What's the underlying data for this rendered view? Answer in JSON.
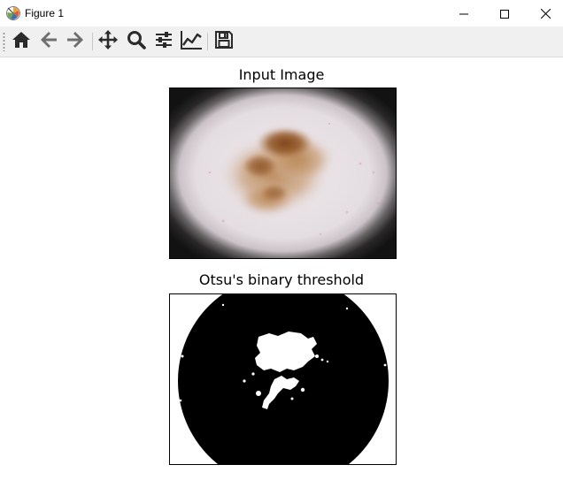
{
  "window": {
    "title": "Figure 1",
    "app_icon": "matplotlib-logo-icon",
    "controls": {
      "minimize_icon": "minimize-icon",
      "maximize_icon": "maximize-icon",
      "close_icon": "close-icon"
    }
  },
  "toolbar": {
    "buttons": [
      {
        "name": "home",
        "icon": "home-icon"
      },
      {
        "name": "back",
        "icon": "arrow-left-icon"
      },
      {
        "name": "forward",
        "icon": "arrow-right-icon"
      },
      {
        "name": "pan",
        "icon": "move-icon"
      },
      {
        "name": "zoom",
        "icon": "magnifier-icon"
      },
      {
        "name": "subplots",
        "icon": "sliders-icon"
      },
      {
        "name": "edit-axes",
        "icon": "chart-line-icon"
      },
      {
        "name": "save",
        "icon": "floppy-disk-icon"
      }
    ]
  },
  "figure": {
    "plots": [
      {
        "title": "Input Image"
      },
      {
        "title": "Otsu's binary threshold"
      }
    ]
  },
  "colors": {
    "toolbar_bg": "#f0f0f0",
    "icon": "#2b2b2b",
    "icon_disabled": "#6f6f6f",
    "skin": "#e6dfe2",
    "lesion_dark": "#8a4f23",
    "lesion_light": "#b07a45",
    "vignette": "#1b1b1b",
    "mask_black": "#000000",
    "mask_white": "#ffffff"
  }
}
